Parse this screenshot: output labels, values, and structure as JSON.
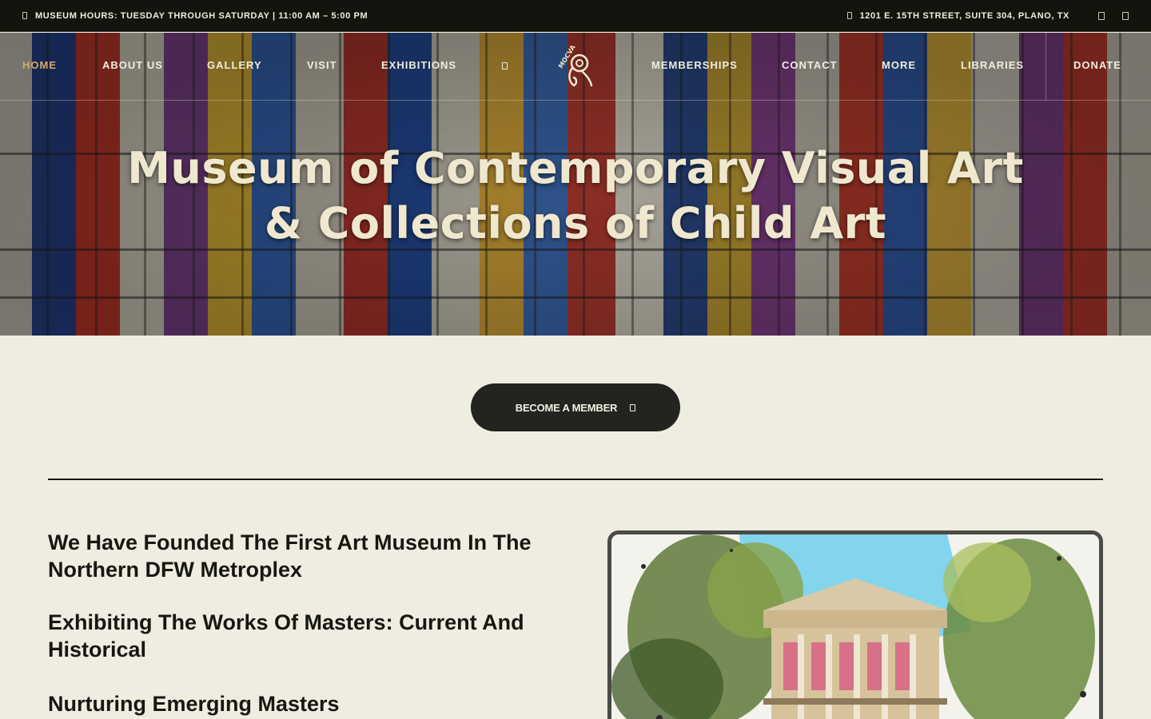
{
  "topbar": {
    "hours": "MUSEUM HOURS: TUESDAY THROUGH SATURDAY | 11:00 AM – 5:00 PM",
    "address": "1201 E. 15TH STREET, SUITE 304, PLANO, TX"
  },
  "nav": {
    "items": [
      "HOME",
      "ABOUT US",
      "GALLERY",
      "VISIT",
      "EXHIBITIONS",
      "MEMBERSHIPS",
      "CONTACT",
      "MORE",
      "LIBRARIES"
    ],
    "donate": "DONATE",
    "logo_text": "MOCVA"
  },
  "hero": {
    "title_line1": "Museum of Contemporary Visual Art",
    "title_line2": "& Collections of Child Art"
  },
  "cta": {
    "label": "BECOME A MEMBER"
  },
  "content": {
    "headline1": "We Have Founded The First Art Museum In The Northern DFW Metroplex",
    "headline2": "Exhibiting The Works Of Masters: Current And Historical",
    "headline3": "Nurturing Emerging Masters"
  },
  "colors": {
    "background": "#efece0",
    "dark": "#14140f",
    "active_nav": "#d9a96a",
    "hero_text": "#efe8cf",
    "button": "#23241f"
  },
  "icons": {
    "hours": "clock-icon",
    "address": "map-pin-icon",
    "social_1": "facebook-icon",
    "social_2": "instagram-icon",
    "nav_caret": "chevron-down-icon",
    "cta": "arrow-right-icon"
  }
}
